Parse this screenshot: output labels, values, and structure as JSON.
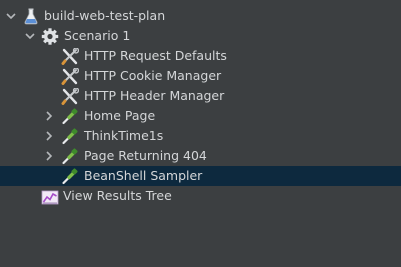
{
  "tree": {
    "root": {
      "label": "build-web-test-plan",
      "icon": "flask-icon",
      "expanded": true
    },
    "thread_group": {
      "label": "Scenario 1",
      "icon": "gear-icon",
      "expanded": true
    },
    "children": [
      {
        "label": "HTTP Request Defaults",
        "icon": "wrench-screwdriver-icon",
        "expandable": false
      },
      {
        "label": "HTTP Cookie Manager",
        "icon": "wrench-screwdriver-icon",
        "expandable": false
      },
      {
        "label": "HTTP Header Manager",
        "icon": "wrench-screwdriver-icon",
        "expandable": false
      },
      {
        "label": "Home Page",
        "icon": "pipette-icon",
        "expandable": true,
        "expanded": false
      },
      {
        "label": "ThinkTime1s",
        "icon": "pipette-icon",
        "expandable": true,
        "expanded": false
      },
      {
        "label": "Page Returning 404",
        "icon": "pipette-icon",
        "expandable": true,
        "expanded": false
      },
      {
        "label": "BeanShell Sampler",
        "icon": "pipette-icon",
        "expandable": false,
        "selected": true
      }
    ],
    "listener": {
      "label": "View Results Tree",
      "icon": "graph-icon"
    }
  },
  "colors": {
    "background": "#3c3f41",
    "selection": "#0d293e",
    "text": "#d4d6d8"
  }
}
